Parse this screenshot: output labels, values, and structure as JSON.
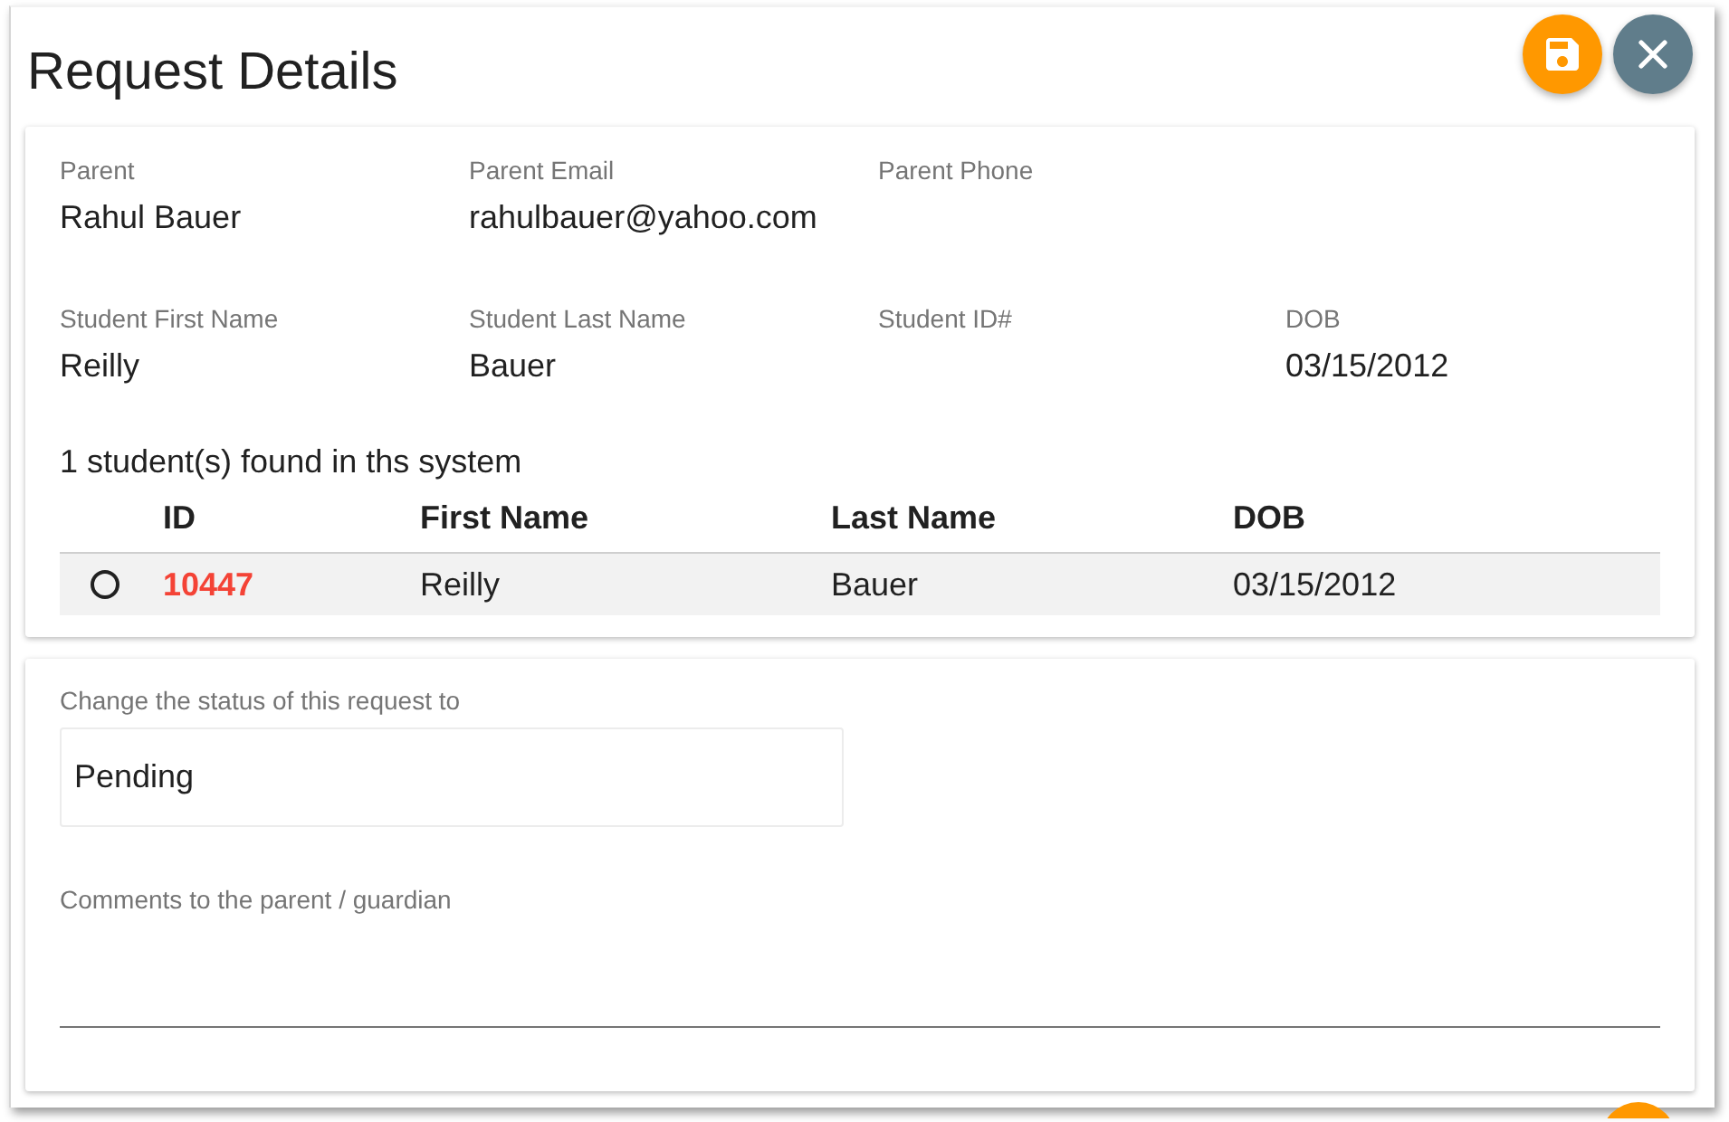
{
  "dialog": {
    "title": "Request Details"
  },
  "details": {
    "parent": [
      {
        "label": "Parent",
        "value": "Rahul Bauer"
      },
      {
        "label": "Parent Email",
        "value": "rahulbauer@yahoo.com"
      },
      {
        "label": "Parent Phone"
      }
    ],
    "student": [
      {
        "label": "Student First Name",
        "value": "Reilly"
      },
      {
        "label": "Student Last Name",
        "value": "Bauer"
      },
      {
        "label": "Student ID#"
      },
      {
        "label": "DOB",
        "value": "03/15/2012"
      }
    ],
    "matches": {
      "summary": "1 student(s) found in ths system",
      "table": {
        "columns": [
          "ID",
          "First Name",
          "Last Name",
          "DOB"
        ],
        "rows": [
          {
            "selected": false,
            "cells": [
              "10447",
              "Reilly",
              "Bauer",
              "03/15/2012"
            ]
          }
        ]
      }
    }
  },
  "status": {
    "label": "Change the status of this request to",
    "select": {
      "value": "Pending"
    }
  },
  "comments": {
    "label": "Comments to the parent / guardian"
  }
}
